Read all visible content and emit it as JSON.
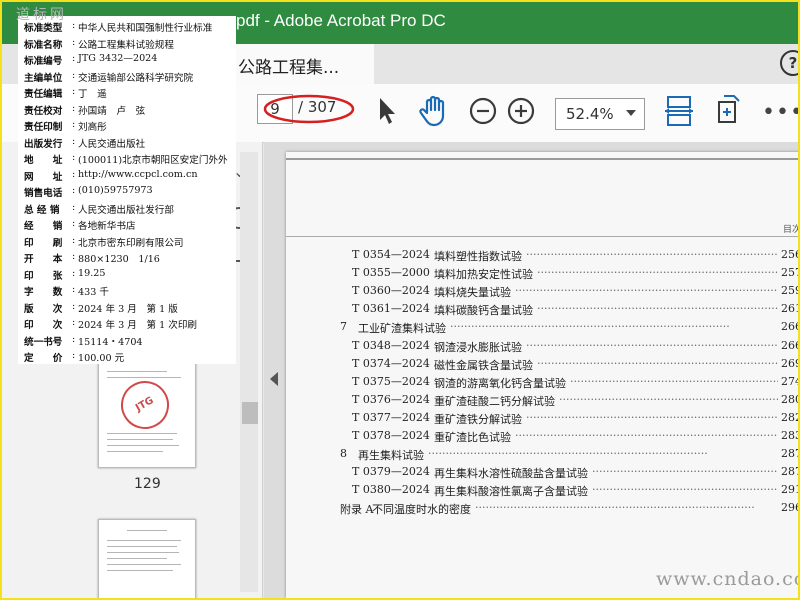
{
  "window": {
    "title": "pdf - Adobe Acrobat Pro DC",
    "accent_color": "#2e8b3f"
  },
  "tab": {
    "label": "公路工程集...",
    "close": "×"
  },
  "toolbar": {
    "help": "?",
    "page_current": "9",
    "page_total": "/ 307",
    "zoom": "52.4%",
    "more": "•••",
    "icons": [
      "select-arrow-icon",
      "hand-tool-icon",
      "zoom-out-icon",
      "zoom-in-icon",
      "fit-width-icon",
      "rotate-pages-icon"
    ]
  },
  "sidebar": {
    "thumb_page_label": "129",
    "stamp_text": "JTG"
  },
  "document": {
    "running_head": "目次",
    "entries": [
      {
        "type": "item",
        "code": "T 0354—2024",
        "name": "填料塑性指数试验",
        "page": "256"
      },
      {
        "type": "item",
        "code": "T 0355—2000",
        "name": "填料加热安定性试验",
        "page": "257"
      },
      {
        "type": "item",
        "code": "T 0360—2024",
        "name": "填料烧失量试验",
        "page": "259"
      },
      {
        "type": "item",
        "code": "T 0361—2024",
        "name": "填料碳酸钙含量试验",
        "page": "261"
      },
      {
        "type": "section",
        "code": "7",
        "name": "工业矿渣集料试验",
        "page": "266"
      },
      {
        "type": "item",
        "code": "T 0348—2024",
        "name": "钢渣浸水膨胀试验",
        "page": "266"
      },
      {
        "type": "item",
        "code": "T 0374—2024",
        "name": "磁性金属铁含量试验",
        "page": "269"
      },
      {
        "type": "item",
        "code": "T 0375—2024",
        "name": "钢渣的游离氧化钙含量试验",
        "page": "274"
      },
      {
        "type": "item",
        "code": "T 0376—2024",
        "name": "重矿渣硅酸二钙分解试验",
        "page": "280"
      },
      {
        "type": "item",
        "code": "T 0377—2024",
        "name": "重矿渣铁分解试验",
        "page": "282"
      },
      {
        "type": "item",
        "code": "T 0378—2024",
        "name": "重矿渣比色试验",
        "page": "283"
      },
      {
        "type": "section",
        "code": "8",
        "name": "再生集料试验",
        "page": "287"
      },
      {
        "type": "item",
        "code": "T 0379—2024",
        "name": "再生集料水溶性硫酸盐含量试验",
        "page": "287"
      },
      {
        "type": "item",
        "code": "T 0380—2024",
        "name": "再生集料酸溶性氯离子含量试验",
        "page": "291"
      },
      {
        "type": "appendix",
        "code": "附录 A",
        "name": "不同温度时水的密度",
        "page": "296"
      }
    ]
  },
  "info_card": {
    "rows": [
      {
        "key": "标准类型",
        "value": "中华人民共和国强制性行业标准"
      },
      {
        "key": "标准名称",
        "value": "公路工程集料试验规程"
      },
      {
        "key": "标准编号",
        "value": "JTG 3432—2024"
      },
      {
        "key": "主编单位",
        "value": "交通运输部公路科学研究院"
      },
      {
        "key": "责任编辑",
        "value": "丁　遥"
      },
      {
        "key": "责任校对",
        "value": "孙国靖　卢　弦"
      },
      {
        "key": "责任印制",
        "value": "刘高彤"
      },
      {
        "key": "出版发行",
        "value": "人民交通出版社"
      },
      {
        "key": "地　　址",
        "value": "(100011)北京市朝阳区安定门外外"
      },
      {
        "key": "网　　址",
        "value": "http://www.ccpcl.com.cn"
      },
      {
        "key": "销售电话",
        "value": "(010)59757973"
      },
      {
        "key": "总 经 销",
        "value": "人民交通出版社发行部"
      },
      {
        "key": "经　　销",
        "value": "各地新华书店"
      },
      {
        "key": "印　　刷",
        "value": "北京市密东印刷有限公司"
      },
      {
        "key": "开　　本",
        "value": "880×1230　1/16"
      },
      {
        "key": "印　　张",
        "value": "19.25"
      },
      {
        "key": "字　　数",
        "value": "433 千"
      },
      {
        "key": "版　　次",
        "value": "2024 年 3 月　第 1 版"
      },
      {
        "key": "印　　次",
        "value": "2024 年 3 月　第 1 次印刷"
      },
      {
        "key": "统一书号",
        "value": "15114・4704"
      },
      {
        "key": "定　　价",
        "value": "100.00 元"
      }
    ]
  },
  "branding": {
    "corner_logo": "道标网",
    "watermark": "www.cndao.com"
  }
}
